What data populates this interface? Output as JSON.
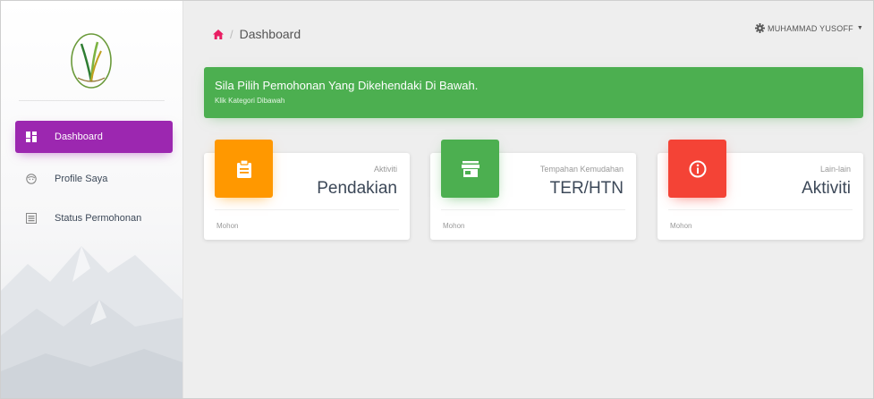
{
  "sidebar": {
    "logo_icon": "pine-emblem-logo",
    "items": [
      {
        "label": "Dashboard",
        "icon": "dashboard-icon",
        "active": true
      },
      {
        "label": "Profile Saya",
        "icon": "face-icon",
        "active": false
      },
      {
        "label": "Status Permohonan",
        "icon": "list-icon",
        "active": false
      }
    ]
  },
  "topbar": {
    "breadcrumb_home_icon": "home-icon",
    "breadcrumb_separator": "/",
    "breadcrumb_current": "Dashboard",
    "user_icon": "gear-icon",
    "user_name": "MUHAMMAD YUSOFF",
    "user_caret": "▼"
  },
  "alert": {
    "title": "Sila Pilih Pemohonan Yang Dikehendaki Di Bawah.",
    "subtitle": "Klik Kategori Dibawah"
  },
  "cards": [
    {
      "category": "Aktiviti",
      "value": "Pendakian",
      "footer": "Mohon",
      "icon": "clipboard-icon",
      "color": "#ff9800"
    },
    {
      "category": "Tempahan Kemudahan",
      "value": "TER/HTN",
      "footer": "Mohon",
      "icon": "store-icon",
      "color": "#4caf50"
    },
    {
      "category": "Lain-lain",
      "value": "Aktiviti",
      "footer": "Mohon",
      "icon": "info-icon",
      "color": "#f44336"
    }
  ],
  "colors": {
    "accent": "#9c27b0",
    "success": "#4caf50",
    "warning": "#ff9800",
    "danger": "#f44336"
  }
}
